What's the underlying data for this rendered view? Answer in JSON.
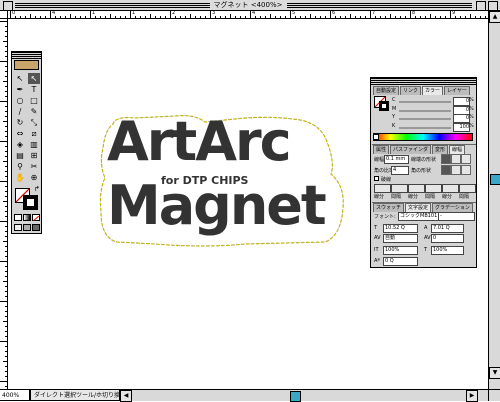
{
  "window": {
    "title": "マグネット <400%>"
  },
  "artwork": {
    "line1": "ArtArc",
    "subtitle": "for DTP CHIPS",
    "line2": "Magnet",
    "text_color": "#333333",
    "outline_color": "#c8b400"
  },
  "ruler": {
    "top_numbers": [
      "0",
      "4",
      "1",
      "1",
      "2",
      "3",
      "4",
      "5",
      "6",
      "7",
      "8",
      "9",
      "10"
    ]
  },
  "status": {
    "zoom": "400%",
    "tool": "ダイレクト選択ツール/ホ切り換え"
  },
  "toolbox": {
    "tools": [
      {
        "name": "selection-tool-icon",
        "glyph": "↖"
      },
      {
        "name": "direct-selection-tool-icon",
        "glyph": "↖"
      },
      {
        "name": "pen-tool-icon",
        "glyph": "✒"
      },
      {
        "name": "type-tool-icon",
        "glyph": "T"
      },
      {
        "name": "ellipse-tool-icon",
        "glyph": "○"
      },
      {
        "name": "rectangle-tool-icon",
        "glyph": "□"
      },
      {
        "name": "brush-tool-icon",
        "glyph": "∕"
      },
      {
        "name": "pencil-tool-icon",
        "glyph": "✎"
      },
      {
        "name": "rotate-tool-icon",
        "glyph": "↻"
      },
      {
        "name": "scale-tool-icon",
        "glyph": "⤡"
      },
      {
        "name": "reflect-tool-icon",
        "glyph": "⇔"
      },
      {
        "name": "shear-tool-icon",
        "glyph": "⧄"
      },
      {
        "name": "blend-tool-icon",
        "glyph": "◈"
      },
      {
        "name": "graph-tool-icon",
        "glyph": "▥"
      },
      {
        "name": "gradient-tool-icon",
        "glyph": "▤"
      },
      {
        "name": "mesh-tool-icon",
        "glyph": "⊞"
      },
      {
        "name": "eyedropper-tool-icon",
        "glyph": "⚲"
      },
      {
        "name": "scissors-tool-icon",
        "glyph": "✂"
      },
      {
        "name": "hand-tool-icon",
        "glyph": "✋"
      },
      {
        "name": "zoom-tool-icon",
        "glyph": "⊕"
      }
    ]
  },
  "palette_color": {
    "tabs": [
      "自動設定",
      "リンク",
      "カラー",
      "レイヤー"
    ],
    "channels": [
      {
        "label": "C",
        "value": "0"
      },
      {
        "label": "M",
        "value": "0"
      },
      {
        "label": "Y",
        "value": "0"
      },
      {
        "label": "K",
        "value": "100"
      }
    ],
    "percent": "%"
  },
  "palette_stroke": {
    "tabs": [
      "属性",
      "パスファインダ",
      "変形",
      "線幅"
    ],
    "weight_label": "線幅",
    "weight_value": "0.1 mm",
    "cap_label": "線端の形状",
    "miter_label": "角の比率",
    "miter_value": "4",
    "join_label": "角の形状",
    "dash_label": "破線",
    "dash_fields": [
      "線分",
      "間隔",
      "線分",
      "間隔",
      "線分",
      "間隔"
    ]
  },
  "palette_type": {
    "tabs": [
      "スウォッチ",
      "文字設定",
      "グラデーション"
    ],
    "font_label": "フォント:",
    "font_value": "ゴシックMB101",
    "font_style": "-",
    "size": "10.52 Q",
    "leading": "7.01 Q",
    "tracking": "自動",
    "kerning": "0",
    "hscale": "100%",
    "vscale": "100%",
    "baseline": "0 Q"
  }
}
